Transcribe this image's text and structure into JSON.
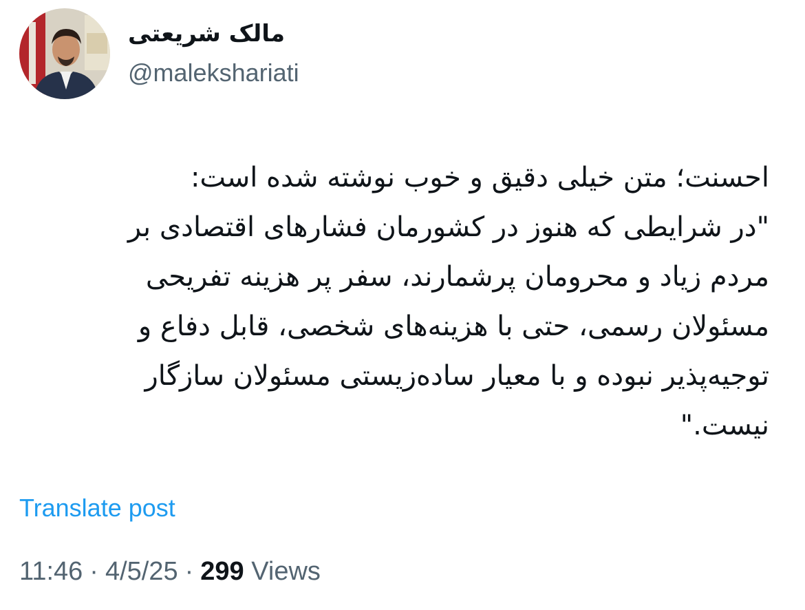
{
  "author": {
    "display_name": "مالک شریعتی",
    "handle": "@malekshariati",
    "avatar": "user-avatar-photo"
  },
  "post": {
    "lines": [
      "احسنت؛ متن خیلی دقیق و خوب نوشته شده است:",
      "\"در شرایطی که هنوز در کشورمان فشارهای اقتصادی بر",
      "مردم زیاد و محرومان پرشمارند، سفر پر هزینه تفریحی",
      "مسئولان رسمی، حتی با هزینه‌های شخصی، قابل دفاع و",
      "توجیه‌پذیر نبوده و با معیار ساده‌زیستی مسئولان سازگار",
      "نیست.\""
    ],
    "translate_label": "Translate post"
  },
  "meta": {
    "time": "11:46",
    "separator": "·",
    "date": "4/5/25",
    "views_count": "299",
    "views_label": "Views"
  },
  "colors": {
    "text": "#0f1419",
    "secondary": "#536471",
    "link": "#1d9bf0"
  }
}
